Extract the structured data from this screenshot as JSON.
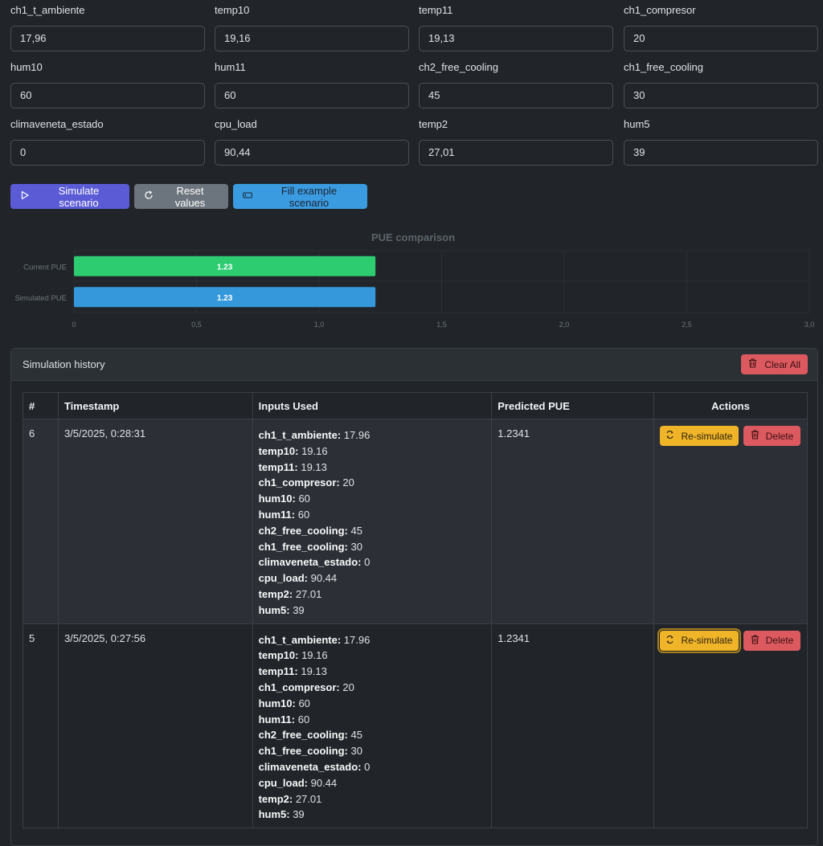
{
  "fields": [
    {
      "label": "ch1_t_ambiente",
      "value": "17,96"
    },
    {
      "label": "temp10",
      "value": "19,16"
    },
    {
      "label": "temp11",
      "value": "19,13"
    },
    {
      "label": "ch1_compresor",
      "value": "20"
    },
    {
      "label": "hum10",
      "value": "60"
    },
    {
      "label": "hum11",
      "value": "60"
    },
    {
      "label": "ch2_free_cooling",
      "value": "45"
    },
    {
      "label": "ch1_free_cooling",
      "value": "30"
    },
    {
      "label": "climaveneta_estado",
      "value": "0"
    },
    {
      "label": "cpu_load",
      "value": "90,44"
    },
    {
      "label": "temp2",
      "value": "27,01"
    },
    {
      "label": "hum5",
      "value": "39"
    }
  ],
  "buttons": {
    "simulate": "Simulate scenario",
    "reset": "Reset values",
    "fill": "Fill example scenario"
  },
  "chart_data": {
    "type": "bar",
    "orientation": "horizontal",
    "title": "PUE comparison",
    "categories": [
      "Current PUE",
      "Simulated PUE"
    ],
    "values": [
      1.23,
      1.23
    ],
    "data_labels": [
      "1.23",
      "1.23"
    ],
    "colors": [
      "#2ecc71",
      "#3498db"
    ],
    "xlim": [
      0,
      3.0
    ],
    "xticks": [
      "0",
      "0,5",
      "1,0",
      "1,5",
      "2,0",
      "2,5",
      "3,0"
    ],
    "grid": true,
    "legend": "none"
  },
  "history": {
    "title": "Simulation history",
    "clear_label": "Clear All",
    "columns": [
      "#",
      "Timestamp",
      "Inputs Used",
      "Predicted PUE",
      "Actions"
    ],
    "resimulate_label": "Re-simulate",
    "delete_label": "Delete",
    "rows": [
      {
        "id": "6",
        "timestamp": "3/5/2025, 0:28:31",
        "pue": "1.2341",
        "inputs": [
          {
            "k": "ch1_t_ambiente:",
            "v": " 17.96"
          },
          {
            "k": "temp10:",
            "v": " 19.16"
          },
          {
            "k": "temp11:",
            "v": " 19.13"
          },
          {
            "k": "ch1_compresor:",
            "v": " 20"
          },
          {
            "k": "hum10:",
            "v": " 60"
          },
          {
            "k": "hum11:",
            "v": " 60"
          },
          {
            "k": "ch2_free_cooling:",
            "v": " 45"
          },
          {
            "k": "ch1_free_cooling:",
            "v": " 30"
          },
          {
            "k": "climaveneta_estado:",
            "v": " 0"
          },
          {
            "k": "cpu_load:",
            "v": " 90.44"
          },
          {
            "k": "temp2:",
            "v": " 27.01"
          },
          {
            "k": "hum5:",
            "v": " 39"
          }
        ]
      },
      {
        "id": "5",
        "timestamp": "3/5/2025, 0:27:56",
        "pue": "1.2341",
        "inputs": [
          {
            "k": "ch1_t_ambiente:",
            "v": " 17.96"
          },
          {
            "k": "temp10:",
            "v": " 19.16"
          },
          {
            "k": "temp11:",
            "v": " 19.13"
          },
          {
            "k": "ch1_compresor:",
            "v": " 20"
          },
          {
            "k": "hum10:",
            "v": " 60"
          },
          {
            "k": "hum11:",
            "v": " 60"
          },
          {
            "k": "ch2_free_cooling:",
            "v": " 45"
          },
          {
            "k": "ch1_free_cooling:",
            "v": " 30"
          },
          {
            "k": "climaveneta_estado:",
            "v": " 0"
          },
          {
            "k": "cpu_load:",
            "v": " 90.44"
          },
          {
            "k": "temp2:",
            "v": " 27.01"
          },
          {
            "k": "hum5:",
            "v": " 39"
          }
        ]
      }
    ]
  }
}
